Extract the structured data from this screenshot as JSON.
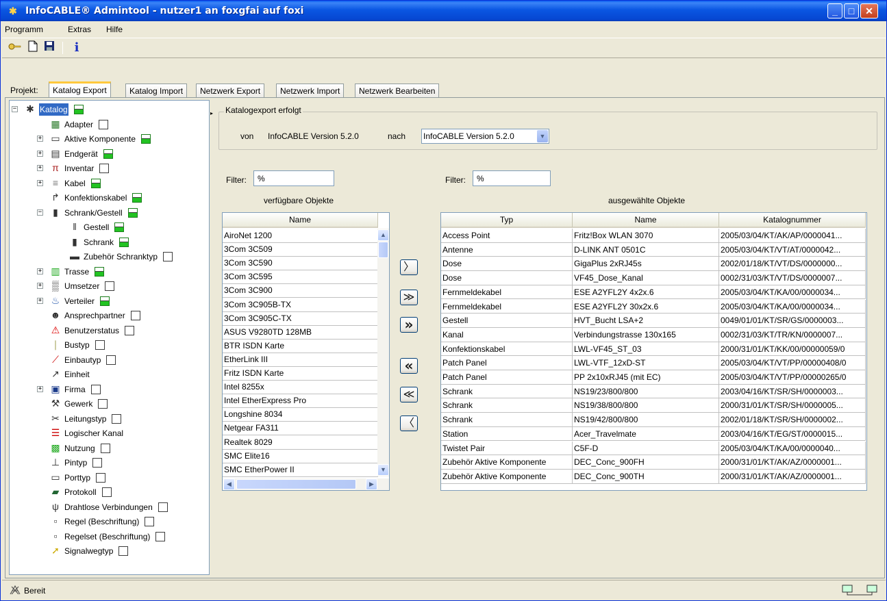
{
  "window": {
    "title": "InfoCABLE® Admintool - nutzer1 an foxgfai auf foxi"
  },
  "menu": [
    "Programm",
    "Extras",
    "Hilfe"
  ],
  "toolbar": {
    "info_glyph": "i"
  },
  "tabs": {
    "prefix": "Projekt:",
    "items": [
      "Katalog Export",
      "Katalog Import",
      "Netzwerk Export",
      "Netzwerk Import",
      "Netzwerk Bearbeiten"
    ],
    "active": "Katalog Export"
  },
  "tree": [
    {
      "label": "Katalog",
      "icon": "katalog-icon",
      "check": "green",
      "expander": "minus",
      "level": 0,
      "selected": true
    },
    {
      "label": "Adapter",
      "icon": "adapter-icon",
      "check": "empty",
      "expander": "",
      "level": 1
    },
    {
      "label": "Aktive Komponente",
      "icon": "switch-icon",
      "check": "green",
      "expander": "plus",
      "level": 1
    },
    {
      "label": "Endgerät",
      "icon": "printer-icon",
      "check": "green",
      "expander": "plus",
      "level": 1
    },
    {
      "label": "Inventar",
      "icon": "table-icon",
      "check": "empty",
      "expander": "plus",
      "level": 1
    },
    {
      "label": "Kabel",
      "icon": "cable-icon",
      "check": "green",
      "expander": "plus",
      "level": 1
    },
    {
      "label": "Konfektionskabel",
      "icon": "patchcable-icon",
      "check": "green",
      "expander": "",
      "level": 1
    },
    {
      "label": "Schrank/Gestell",
      "icon": "cabinet-icon",
      "check": "green",
      "expander": "minus",
      "level": 1
    },
    {
      "label": "Gestell",
      "icon": "rack-icon",
      "check": "green",
      "expander": "",
      "level": 2
    },
    {
      "label": "Schrank",
      "icon": "cabinet-icon",
      "check": "green",
      "expander": "",
      "level": 2
    },
    {
      "label": "Zubehör Schranktyp",
      "icon": "accessory-icon",
      "check": "empty",
      "expander": "",
      "level": 2
    },
    {
      "label": "Trasse",
      "icon": "trasse-icon",
      "check": "green",
      "expander": "plus",
      "level": 1
    },
    {
      "label": "Umsetzer",
      "icon": "converter-icon",
      "check": "empty",
      "expander": "plus",
      "level": 1
    },
    {
      "label": "Verteiler",
      "icon": "distributor-icon",
      "check": "green",
      "expander": "plus",
      "level": 1
    },
    {
      "label": "Ansprechpartner",
      "icon": "person-icon",
      "check": "empty",
      "expander": "",
      "level": 1
    },
    {
      "label": "Benutzerstatus",
      "icon": "warning-icon",
      "check": "empty",
      "expander": "",
      "level": 1
    },
    {
      "label": "Bustyp",
      "icon": "bus-icon",
      "check": "empty",
      "expander": "",
      "level": 1
    },
    {
      "label": "Einbautyp",
      "icon": "screwdriver-icon",
      "check": "empty",
      "expander": "",
      "level": 1
    },
    {
      "label": "Einheit",
      "icon": "caliper-icon",
      "check": "none",
      "expander": "",
      "level": 1
    },
    {
      "label": "Firma",
      "icon": "building-icon",
      "check": "empty",
      "expander": "plus",
      "level": 1
    },
    {
      "label": "Gewerk",
      "icon": "tools-icon",
      "check": "empty",
      "expander": "",
      "level": 1
    },
    {
      "label": "Leitungstyp",
      "icon": "wire-icon",
      "check": "empty",
      "expander": "",
      "level": 1
    },
    {
      "label": "Logischer Kanal",
      "icon": "channel-icon",
      "check": "none",
      "expander": "",
      "level": 1
    },
    {
      "label": "Nutzung",
      "icon": "usage-icon",
      "check": "empty",
      "expander": "",
      "level": 1
    },
    {
      "label": "Pintyp",
      "icon": "pin-icon",
      "check": "empty",
      "expander": "",
      "level": 1
    },
    {
      "label": "Porttyp",
      "icon": "port-icon",
      "check": "empty",
      "expander": "",
      "level": 1
    },
    {
      "label": "Protokoll",
      "icon": "protocol-icon",
      "check": "empty",
      "expander": "",
      "level": 1
    },
    {
      "label": "Drahtlose Verbindungen",
      "icon": "antenna-icon",
      "check": "empty",
      "expander": "",
      "level": 1
    },
    {
      "label": "Regel (Beschriftung)",
      "icon": "rule-icon",
      "check": "empty",
      "expander": "",
      "level": 1
    },
    {
      "label": "Regelset (Beschriftung)",
      "icon": "ruleset-icon",
      "check": "empty",
      "expander": "",
      "level": 1
    },
    {
      "label": "Signalwegtyp",
      "icon": "signal-icon",
      "check": "empty",
      "expander": "",
      "level": 1
    }
  ],
  "export": {
    "group_title": "Katalogexport erfolgt",
    "von_label": "von",
    "from_version": "InfoCABLE Version 5.2.0",
    "nach_label": "nach",
    "to_version": "InfoCABLE Version 5.2.0"
  },
  "available": {
    "filter_label": "Filter:",
    "filter_value": "%",
    "title": "verfügbare Objekte",
    "header": "Name",
    "rows": [
      "AiroNet 1200",
      "3Com 3C509",
      "3Com 3C590",
      "3Com 3C595",
      "3Com 3C900",
      "3Com 3C905B-TX",
      "3Com 3C905C-TX",
      "ASUS V9280TD 128MB",
      "BTR ISDN Karte",
      "EtherLink III",
      "Fritz ISDN Karte",
      "Intel 8255x",
      "Intel EtherExpress Pro",
      "Longshine 8034",
      "Netgear FA311",
      "Realtek 8029",
      "SMC Elite16",
      "SMC EtherPower II"
    ]
  },
  "transfer_buttons": [
    {
      "name": "add-one-button",
      "glyph": "〉"
    },
    {
      "name": "add-selected-button",
      "glyph": "≫"
    },
    {
      "name": "add-all-button",
      "glyph": "»"
    },
    {
      "name": "remove-all-button",
      "glyph": "«"
    },
    {
      "name": "remove-selected-button",
      "glyph": "≪"
    },
    {
      "name": "remove-one-button",
      "glyph": "〈"
    }
  ],
  "selected": {
    "filter_label": "Filter:",
    "filter_value": "%",
    "title": "ausgewählte Objekte",
    "headers": [
      "Typ",
      "Name",
      "Katalognummer"
    ],
    "rows": [
      [
        "Access Point",
        "Fritz!Box WLAN 3070",
        "2005/03/04/KT/AK/AP/0000041..."
      ],
      [
        "Antenne",
        "D-LINK ANT 0501C",
        "2005/03/04/KT/VT/AT/0000042..."
      ],
      [
        "Dose",
        "GigaPlus 2xRJ45s",
        "2002/01/18/KT/VT/DS/0000000..."
      ],
      [
        "Dose",
        "VF45_Dose_Kanal",
        "0002/31/03/KT/VT/DS/0000007..."
      ],
      [
        "Fernmeldekabel",
        "ESE A2YFL2Y  4x2x.6",
        "2005/03/04/KT/KA/00/0000034..."
      ],
      [
        "Fernmeldekabel",
        "ESE A2YFL2Y  30x2x.6",
        "2005/03/04/KT/KA/00/0000034..."
      ],
      [
        "Gestell",
        "HVT_Bucht LSA+2",
        "0049/01/01/KT/SR/GS/0000003..."
      ],
      [
        "Kanal",
        "Verbindungstrasse 130x165",
        "0002/31/03/KT/TR/KN/0000007..."
      ],
      [
        "Konfektionskabel",
        "LWL-VF45_ST_03",
        "2000/31/01/KT/KK/00/00000059/0"
      ],
      [
        "Patch Panel",
        "LWL-VTF_12xD-ST",
        "2005/03/04/KT/VT/PP/00000408/0"
      ],
      [
        "Patch Panel",
        "PP 2x10xRJ45 (mit EC)",
        "2005/03/04/KT/VT/PP/00000265/0"
      ],
      [
        "Schrank",
        "NS19/23/800/800",
        "2003/04/16/KT/SR/SH/0000003..."
      ],
      [
        "Schrank",
        "NS19/38/800/800",
        "2000/31/01/KT/SR/SH/0000005..."
      ],
      [
        "Schrank",
        "NS19/42/800/800",
        "2002/01/18/KT/SR/SH/0000002..."
      ],
      [
        "Station",
        "Acer_Travelmate",
        "2003/04/16/KT/EG/ST/0000015..."
      ],
      [
        "Twistet Pair",
        "C5F-D",
        "2005/03/04/KT/KA/00/0000040..."
      ],
      [
        "Zubehör Aktive Komponente",
        "DEC_Conc_900FH",
        "2000/31/01/KT/AK/AZ/0000001..."
      ],
      [
        "Zubehör Aktive Komponente",
        "DEC_Conc_900TH",
        "2000/31/01/KT/AK/AZ/0000001..."
      ]
    ]
  },
  "status": {
    "text": "Bereit"
  }
}
